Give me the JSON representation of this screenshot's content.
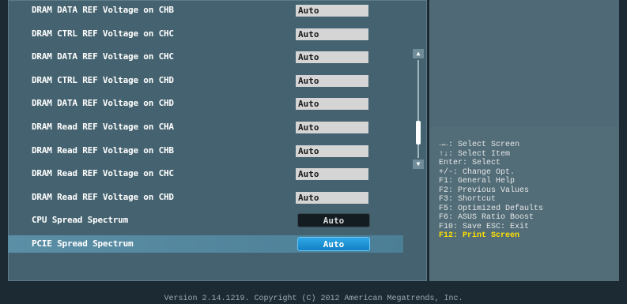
{
  "settings": [
    {
      "label": "DRAM DATA REF Voltage on CHB",
      "value": "Auto",
      "style": "field"
    },
    {
      "label": "DRAM CTRL REF Voltage on CHC",
      "value": "Auto",
      "style": "field"
    },
    {
      "label": "DRAM DATA REF Voltage on CHC",
      "value": "Auto",
      "style": "field"
    },
    {
      "label": "DRAM CTRL REF Voltage on CHD",
      "value": "Auto",
      "style": "field"
    },
    {
      "label": "DRAM DATA REF Voltage on CHD",
      "value": "Auto",
      "style": "field"
    },
    {
      "label": "DRAM Read REF Voltage on CHA",
      "value": "Auto",
      "style": "field"
    },
    {
      "label": "DRAM Read REF Voltage on CHB",
      "value": "Auto",
      "style": "field"
    },
    {
      "label": "DRAM Read REF Voltage on CHC",
      "value": "Auto",
      "style": "field"
    },
    {
      "label": "DRAM Read REF Voltage on CHD",
      "value": "Auto",
      "style": "field"
    },
    {
      "label": "CPU Spread Spectrum",
      "value": "Auto",
      "style": "button"
    },
    {
      "label": "PCIE Spread Spectrum",
      "value": "Auto",
      "style": "button",
      "selected": true
    }
  ],
  "help": [
    "→←: Select Screen",
    "↑↓: Select Item",
    "Enter: Select",
    "+/-: Change Opt.",
    "F1: General Help",
    "F2: Previous Values",
    "F3: Shortcut",
    "F5: Optimized Defaults",
    "F6: ASUS Ratio Boost",
    "F10: Save  ESC: Exit",
    "F12: Print Screen"
  ],
  "help_highlight_index": 10,
  "scrollbar": {
    "position": 0.82
  },
  "footer": "Version 2.14.1219. Copyright (C) 2012 American Megatrends, Inc.",
  "colors": {
    "panel": "#44626f",
    "selected": "#5b8fa6",
    "highlight": "#ffe000"
  }
}
